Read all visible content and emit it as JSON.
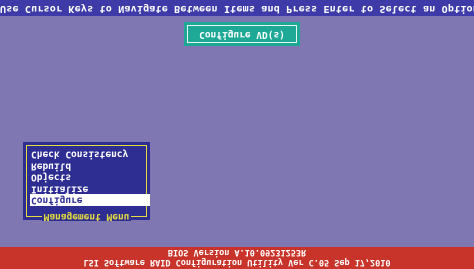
{
  "top_bar": {
    "text": "Use Cursor Keys to Navigate Between Items and Press Enter to Select an Option"
  },
  "title_box": {
    "label": "Configure VD(s)"
  },
  "menu": {
    "caption": "Management Menu",
    "items": [
      {
        "label": "Check Consistency",
        "selected": false
      },
      {
        "label": "Rebuild",
        "selected": false
      },
      {
        "label": "Objects",
        "selected": false
      },
      {
        "label": "Initialize",
        "selected": false
      },
      {
        "label": "Configure",
        "selected": true
      }
    ]
  },
  "bottom_bar": {
    "line1": "BIOS Version  A.10.09231253R",
    "line2": "LSI Software RAID Configuration Utility Ver C.05 Sep 17,2010"
  },
  "colors": {
    "background": "#7f77b1",
    "top_bar": "#3e3ba8",
    "title_box": "#1ea896",
    "menu_bg": "#2e2d92",
    "menu_border": "#e6dc3c",
    "bottom_bar": "#c8342a"
  }
}
